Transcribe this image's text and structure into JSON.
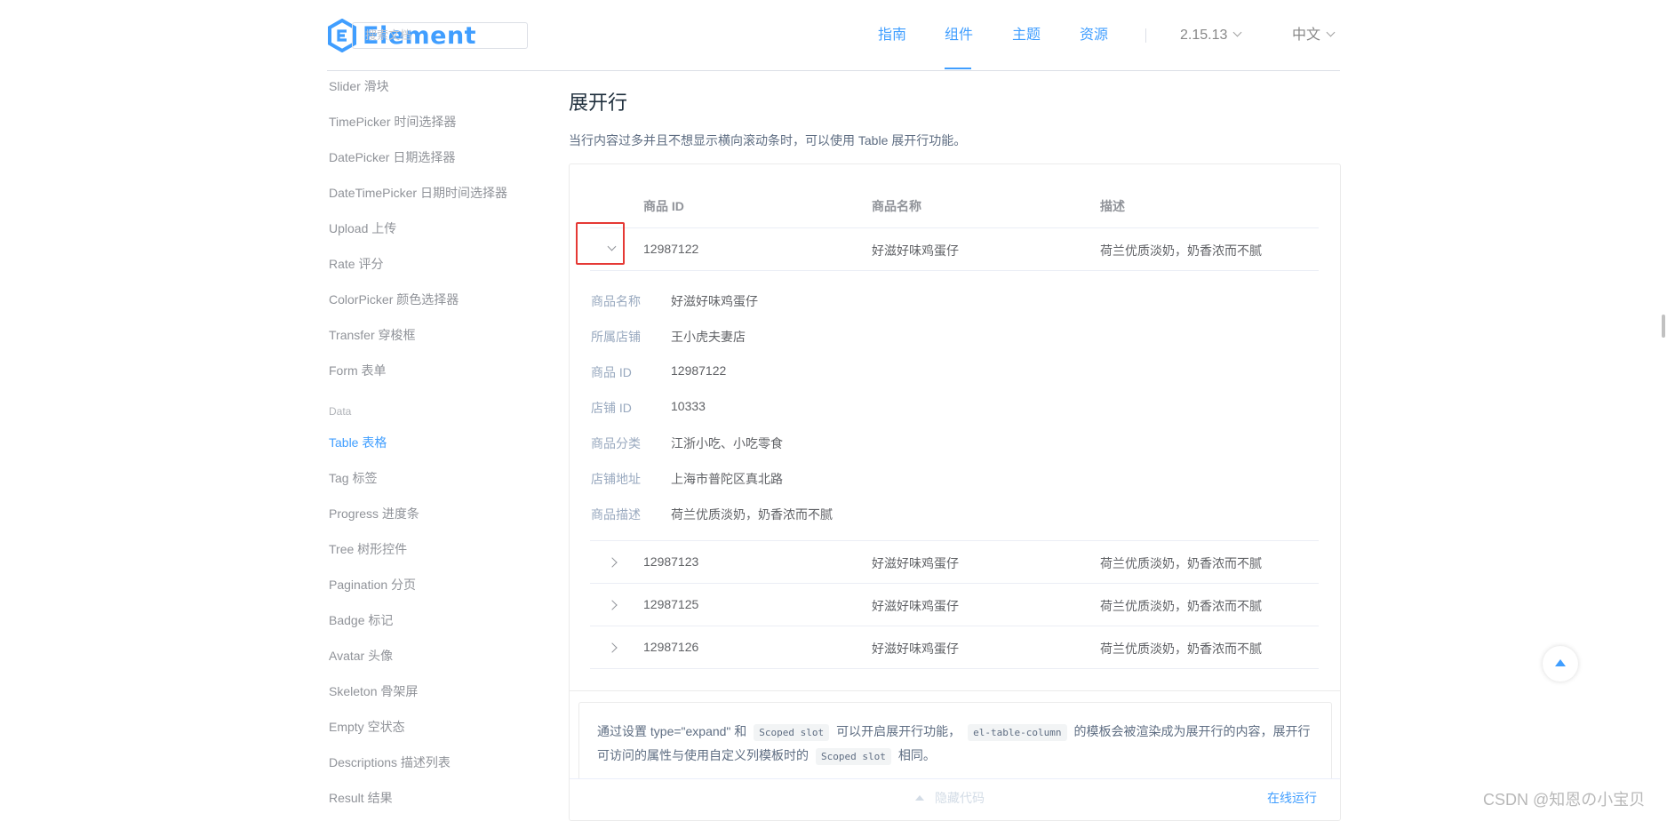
{
  "header": {
    "logo_text": "Element",
    "search_placeholder": "搜索文档",
    "nav": [
      "指南",
      "组件",
      "主题",
      "资源"
    ],
    "version": "2.15.13",
    "language": "中文"
  },
  "sidebar": {
    "items_top": [
      "Slider 滑块",
      "TimePicker 时间选择器",
      "DatePicker 日期选择器",
      "DateTimePicker 日期时间选择器",
      "Upload 上传",
      "Rate 评分",
      "ColorPicker 颜色选择器",
      "Transfer 穿梭框",
      "Form 表单"
    ],
    "group_label": "Data",
    "items_bottom": [
      "Table 表格",
      "Tag 标签",
      "Progress 进度条",
      "Tree 树形控件",
      "Pagination 分页",
      "Badge 标记",
      "Avatar 头像",
      "Skeleton 骨架屏",
      "Empty 空状态",
      "Descriptions 描述列表",
      "Result 结果"
    ]
  },
  "main": {
    "title": "展开行",
    "description": "当行内容过多并且不想显示横向滚动条时，可以使用 Table 展开行功能。",
    "table": {
      "headers": [
        "商品 ID",
        "商品名称",
        "描述"
      ],
      "rows": [
        [
          "12987122",
          "好滋好味鸡蛋仔",
          "荷兰优质淡奶，奶香浓而不腻"
        ],
        [
          "12987123",
          "好滋好味鸡蛋仔",
          "荷兰优质淡奶，奶香浓而不腻"
        ],
        [
          "12987125",
          "好滋好味鸡蛋仔",
          "荷兰优质淡奶，奶香浓而不腻"
        ],
        [
          "12987126",
          "好滋好味鸡蛋仔",
          "荷兰优质淡奶，奶香浓而不腻"
        ]
      ],
      "expanded": [
        [
          "商品名称",
          "好滋好味鸡蛋仔"
        ],
        [
          "所属店铺",
          "王小虎夫妻店"
        ],
        [
          "商品 ID",
          "12987122"
        ],
        [
          "店铺 ID",
          "10333"
        ],
        [
          "商品分类",
          "江浙小吃、小吃零食"
        ],
        [
          "店铺地址",
          "上海市普陀区真北路"
        ],
        [
          "商品描述",
          "荷兰优质淡奶，奶香浓而不腻"
        ]
      ]
    },
    "info": {
      "line1_a": "通过设置 type=\"expand\" 和",
      "code1": "Scoped slot",
      "line1_b": "可以开启展开行功能，",
      "code2": "el-table-column",
      "line1_c": "的模板会被渲染成为展开行的内容，展开行",
      "line2_a": "可访问的属性与使用自定义列模板时的",
      "code3": "Scoped slot",
      "line2_b": "相同。"
    },
    "hide_code": "隐藏代码",
    "run_online": "在线运行"
  },
  "watermark": "CSDN @知恩の小宝贝",
  "colors": {
    "accent": "#409eff",
    "highlight": "#e53935"
  }
}
